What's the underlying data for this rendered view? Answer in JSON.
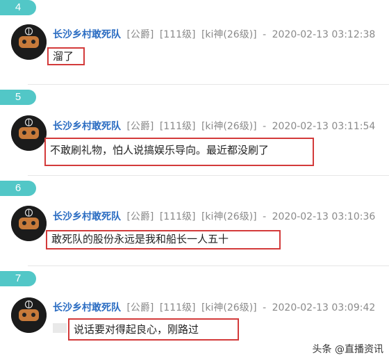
{
  "comments": [
    {
      "floor": "4",
      "author": "长沙乡村敢死队",
      "tags": [
        "[公爵]",
        "[111级]",
        "[ki神(26级)]"
      ],
      "separator": "-",
      "timestamp": "2020-02-13 03:12:38",
      "text": "溜了"
    },
    {
      "floor": "5",
      "author": "长沙乡村敢死队",
      "tags": [
        "[公爵]",
        "[111级]",
        "[ki神(26级)]"
      ],
      "separator": "-",
      "timestamp": "2020-02-13 03:11:54",
      "text": "不敢刷礼物，怕人说搞娱乐导向。最近都没刷了"
    },
    {
      "floor": "6",
      "author": "长沙乡村敢死队",
      "tags": [
        "[公爵]",
        "[111级]",
        "[ki神(26级)]"
      ],
      "separator": "-",
      "timestamp": "2020-02-13 03:10:36",
      "text": "敢死队的股份永远是我和船长一人五十"
    },
    {
      "floor": "7",
      "author": "长沙乡村敢死队",
      "tags": [
        "[公爵]",
        "[111级]",
        "[ki神(26级)]"
      ],
      "separator": "-",
      "timestamp": "2020-02-13 03:09:42",
      "text": "说话要对得起良心，刚路过"
    }
  ],
  "avatar_caption": "长沙乡村敢死队",
  "watermark": "头条 @直播资讯",
  "colors": {
    "floor_tab": "#52c7c7",
    "author": "#2a6cc2",
    "highlight_box": "#d33a3a"
  }
}
